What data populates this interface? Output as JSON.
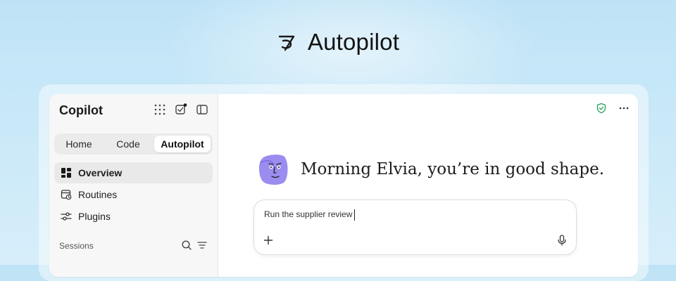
{
  "hero": {
    "title": "Autopilot",
    "logo_icon": "autopilot-logo-icon"
  },
  "app": {
    "brand": "Copilot",
    "top_icons": [
      "apps-grid-icon",
      "tasks-check-icon",
      "sidebar-toggle-icon"
    ],
    "notification_dot_color": "#1a1a1a"
  },
  "tabs": [
    {
      "label": "Home",
      "active": false
    },
    {
      "label": "Code",
      "active": false
    },
    {
      "label": "Autopilot",
      "active": true
    }
  ],
  "nav": [
    {
      "label": "Overview",
      "icon": "overview-icon",
      "active": true
    },
    {
      "label": "Routines",
      "icon": "routines-icon",
      "active": false
    },
    {
      "label": "Plugins",
      "icon": "plugins-icon",
      "active": false
    }
  ],
  "sessions": {
    "label": "Sessions",
    "icons": [
      "search-icon",
      "filter-icon"
    ]
  },
  "header": {
    "icons": [
      "shield-check-icon",
      "more-icon"
    ],
    "shield_color": "#1f9d55"
  },
  "greeting": "Morning Elvia, you’re in good shape.",
  "avatar": {
    "icon": "avatar-character-icon",
    "color": "#9b8cf0"
  },
  "composer": {
    "value": "Run the supplier review",
    "icons": [
      "plus-icon",
      "mic-icon"
    ]
  }
}
